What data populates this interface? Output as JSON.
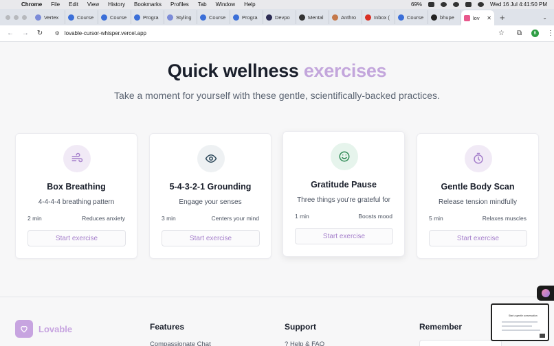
{
  "menubar": {
    "app": "Chrome",
    "items": [
      "File",
      "Edit",
      "View",
      "History",
      "Bookmarks",
      "Profiles",
      "Tab",
      "Window",
      "Help"
    ],
    "battery": "69%",
    "datetime": "Wed 16 Jul  4:41:50 PM"
  },
  "tabs": [
    {
      "label": "Vertex",
      "color": "#7b8bd8"
    },
    {
      "label": "Course",
      "color": "#3b6fd8"
    },
    {
      "label": "Course",
      "color": "#3b6fd8"
    },
    {
      "label": "Progra",
      "color": "#3b6fd8"
    },
    {
      "label": "Styling",
      "color": "#7b8bd8"
    },
    {
      "label": "Course",
      "color": "#3b6fd8"
    },
    {
      "label": "Progra",
      "color": "#3b6fd8"
    },
    {
      "label": "Devpo",
      "color": "#2c2c54"
    },
    {
      "label": "Mental",
      "color": "#333333"
    },
    {
      "label": "Anthro",
      "color": "#c4784a"
    },
    {
      "label": "Inbox (",
      "color": "#d93025"
    },
    {
      "label": "Course",
      "color": "#3b6fd8"
    },
    {
      "label": "bhupe",
      "color": "#222222"
    }
  ],
  "active_tab": {
    "label": "lov",
    "color": "#e8588c"
  },
  "address": {
    "url": "lovable-cursor-whisper.vercel.app",
    "profile_initial": "B"
  },
  "hero": {
    "title_main": "Quick wellness ",
    "title_accent": "exercises",
    "subtitle": "Take a moment for yourself with these gentle, scientifically-backed practices."
  },
  "cards": [
    {
      "title": "Box Breathing",
      "desc": "4-4-4-4 breathing pattern",
      "duration": "2 min",
      "benefit": "Reduces anxiety",
      "button": "Start exercise",
      "icon": "wind-icon",
      "icon_bg": "#f1eaf6",
      "icon_color": "#a57fcb"
    },
    {
      "title": "5-4-3-2-1 Grounding",
      "desc": "Engage your senses",
      "duration": "3 min",
      "benefit": "Centers your mind",
      "button": "Start exercise",
      "icon": "eye-icon",
      "icon_bg": "#eef1f3",
      "icon_color": "#2f4a5c"
    },
    {
      "title": "Gratitude Pause",
      "desc": "Three things you're grateful for",
      "duration": "1 min",
      "benefit": "Boosts mood",
      "button": "Start exercise",
      "icon": "smile-icon",
      "icon_bg": "#e6f4ec",
      "icon_color": "#2e8a55"
    },
    {
      "title": "Gentle Body Scan",
      "desc": "Release tension mindfully",
      "duration": "5 min",
      "benefit": "Relaxes muscles",
      "button": "Start exercise",
      "icon": "timer-icon",
      "icon_bg": "#f1eaf6",
      "icon_color": "#a57fcb"
    }
  ],
  "footer": {
    "brand": "Lovable",
    "col1_title": "Features",
    "col1_link": "Compassionate Chat",
    "col2_title": "Support",
    "col2_link": "Help & FAQ",
    "col3_title": "Remember"
  },
  "pip": {
    "title": "Start a gentle conversation"
  }
}
